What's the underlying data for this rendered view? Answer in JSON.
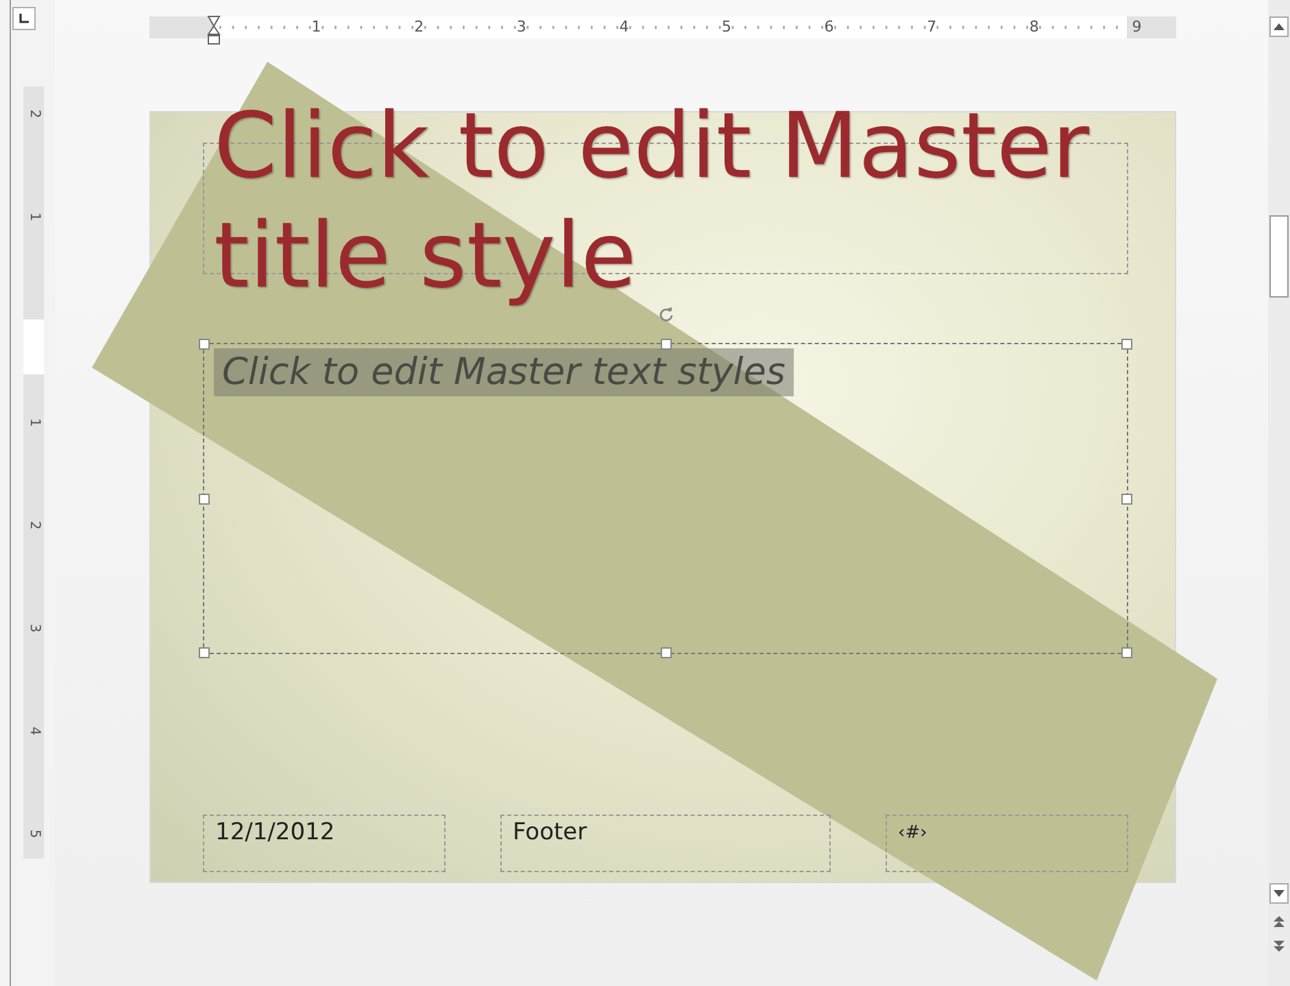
{
  "top_ruler": {
    "labels": [
      "1",
      "2",
      "3",
      "4",
      "5",
      "6",
      "7",
      "8",
      "9"
    ]
  },
  "left_ruler": {
    "above": [
      "2",
      "1"
    ],
    "below": [
      "1",
      "2",
      "3",
      "4",
      "5"
    ]
  },
  "slide": {
    "title": {
      "text": "Click to edit Master title style",
      "kind": "title"
    },
    "body": {
      "text": "Click to edit Master text styles",
      "selected": true
    },
    "footers": [
      {
        "kind": "date",
        "text": "12/1/2012"
      },
      {
        "kind": "footer",
        "text": "Footer"
      },
      {
        "kind": "number",
        "text": "‹#›"
      }
    ]
  }
}
